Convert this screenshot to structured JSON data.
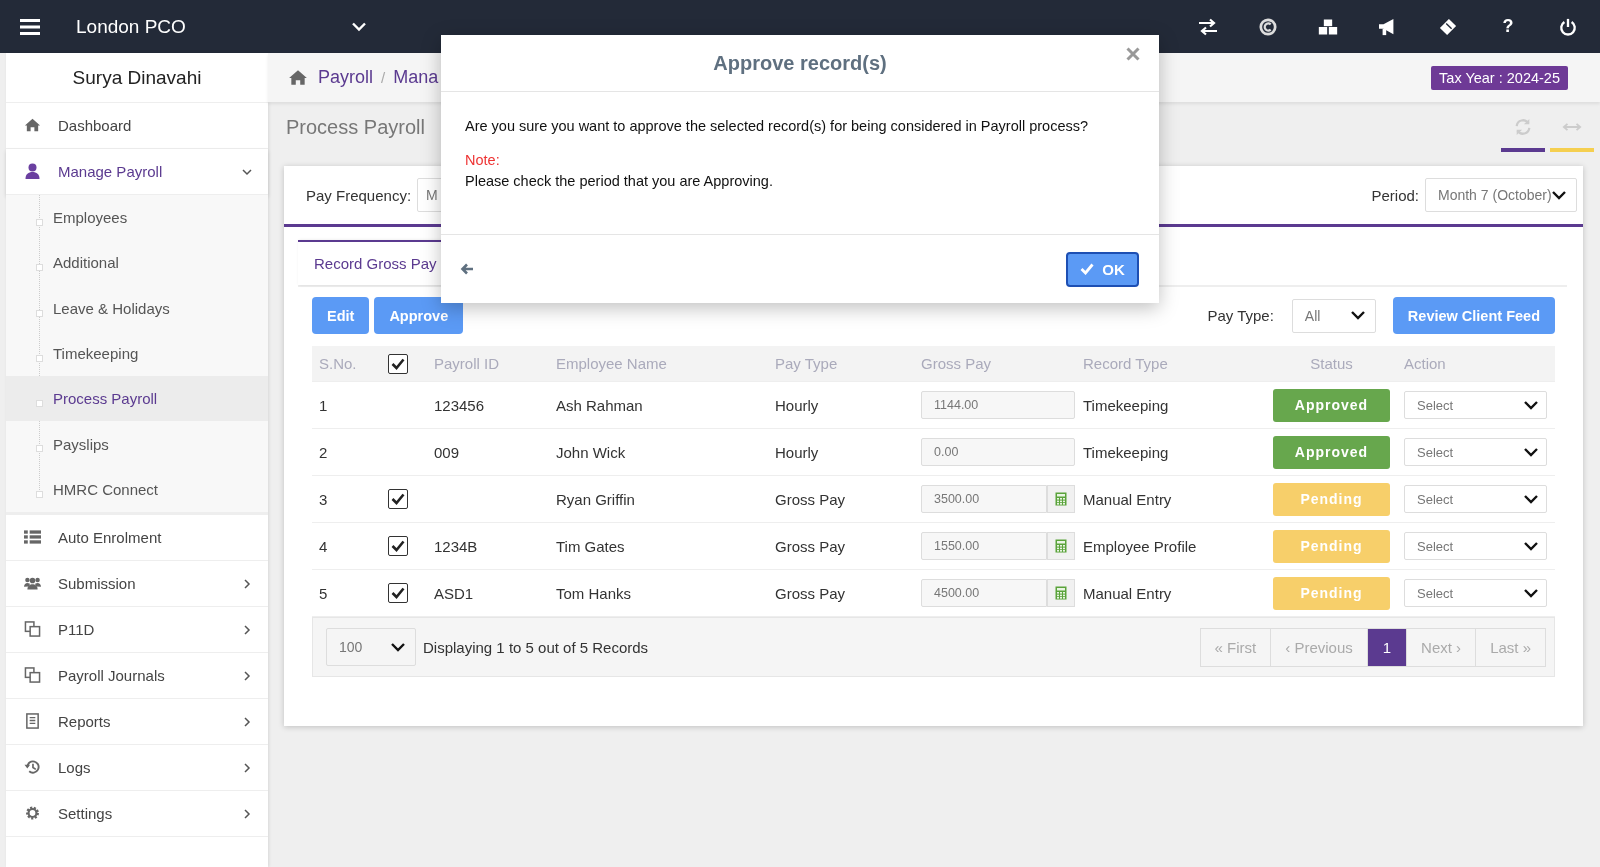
{
  "topbar": {
    "company": "London PCO",
    "help": "?"
  },
  "user_name": "Surya Dinavahi",
  "sidebar": {
    "items": [
      {
        "label": "Dashboard",
        "selected": false
      },
      {
        "label": "Manage Payroll",
        "expanded": true,
        "selected": true,
        "children": [
          {
            "label": "Employees",
            "selected": false
          },
          {
            "label": "Additional",
            "selected": false
          },
          {
            "label": "Leave & Holidays",
            "selected": false
          },
          {
            "label": "Timekeeping",
            "selected": false
          },
          {
            "label": "Process Payroll",
            "selected": true
          },
          {
            "label": "Payslips",
            "selected": false
          },
          {
            "label": "HMRC Connect",
            "selected": false
          }
        ]
      },
      {
        "label": "Auto Enrolment",
        "selected": false
      },
      {
        "label": "Submission",
        "expanded": false,
        "selected": false
      },
      {
        "label": "P11D",
        "expanded": false,
        "selected": false
      },
      {
        "label": "Payroll Journals",
        "expanded": false,
        "selected": false
      },
      {
        "label": "Reports",
        "expanded": false,
        "selected": false
      },
      {
        "label": "Logs",
        "expanded": false,
        "selected": false
      },
      {
        "label": "Settings",
        "expanded": false,
        "selected": false
      }
    ]
  },
  "breadcrumb": {
    "items": [
      "Payroll",
      "Mana"
    ],
    "separator": "/"
  },
  "tax_year": "Tax Year : 2024-25",
  "page_title": "Process Payroll",
  "filters": {
    "pay_frequency": {
      "label": "Pay Frequency:",
      "value": "M"
    },
    "period": {
      "label": "Period:",
      "value": "Month 7 (October)"
    }
  },
  "tabs": [
    {
      "label": "Record Gross Pay",
      "selected": true
    }
  ],
  "actions": [
    "Edit",
    "Approve"
  ],
  "pay_type": {
    "label": "Pay Type:",
    "value": "All"
  },
  "review_button": "Review Client Feed",
  "table": {
    "columns": [
      "S.No.",
      "Payroll ID",
      "Employee Name",
      "Pay Type",
      "Gross Pay",
      "Record Type",
      "Status",
      "Action"
    ],
    "select_all": {
      "checked": true
    },
    "rows": [
      {
        "sno": "1",
        "selectable": false,
        "payroll_id": "123456",
        "name": "Ash Rahman",
        "pay_type": "Hourly",
        "gross_pay": "1144.00",
        "calculator": false,
        "record_type": "Timekeeping",
        "status": {
          "label": "Approved",
          "kind": "approved"
        },
        "action": "Select"
      },
      {
        "sno": "2",
        "selectable": false,
        "payroll_id": "009",
        "name": "John Wick",
        "pay_type": "Hourly",
        "gross_pay": "0.00",
        "calculator": false,
        "record_type": "Timekeeping",
        "status": {
          "label": "Approved",
          "kind": "approved"
        },
        "action": "Select"
      },
      {
        "sno": "3",
        "selectable": true,
        "checked": true,
        "name": "Ryan Griffin",
        "pay_type": "Gross Pay",
        "gross_pay": "3500.00",
        "calculator": true,
        "record_type": "Manual Entry",
        "status": {
          "label": "Pending",
          "kind": "pending"
        },
        "action": "Select"
      },
      {
        "sno": "4",
        "selectable": true,
        "checked": true,
        "payroll_id": "1234B",
        "name": "Tim Gates",
        "pay_type": "Gross Pay",
        "gross_pay": "1550.00",
        "calculator": true,
        "record_type": "Employee Profile",
        "status": {
          "label": "Pending",
          "kind": "pending"
        },
        "action": "Select"
      },
      {
        "sno": "5",
        "selectable": true,
        "checked": true,
        "payroll_id": "ASD1",
        "name": "Tom Hanks",
        "pay_type": "Gross Pay",
        "gross_pay": "4500.00",
        "calculator": true,
        "record_type": "Manual Entry",
        "status": {
          "label": "Pending",
          "kind": "pending"
        },
        "action": "Select"
      }
    ]
  },
  "footer": {
    "page_size": "100",
    "summary": "Displaying 1 to 5 out of 5 Records",
    "first": "« First",
    "previous": "‹ Previous",
    "pages": [
      {
        "label": "1",
        "selected": true
      }
    ],
    "next": "Next ›",
    "last": "Last »"
  },
  "modal": {
    "title": "Approve record(s)",
    "message": "Are you sure you want to approve the selected record(s) for being considered in Payroll process?",
    "note_label": "Note:",
    "note": "Please check the period that you are Approving.",
    "ok": "OK"
  }
}
